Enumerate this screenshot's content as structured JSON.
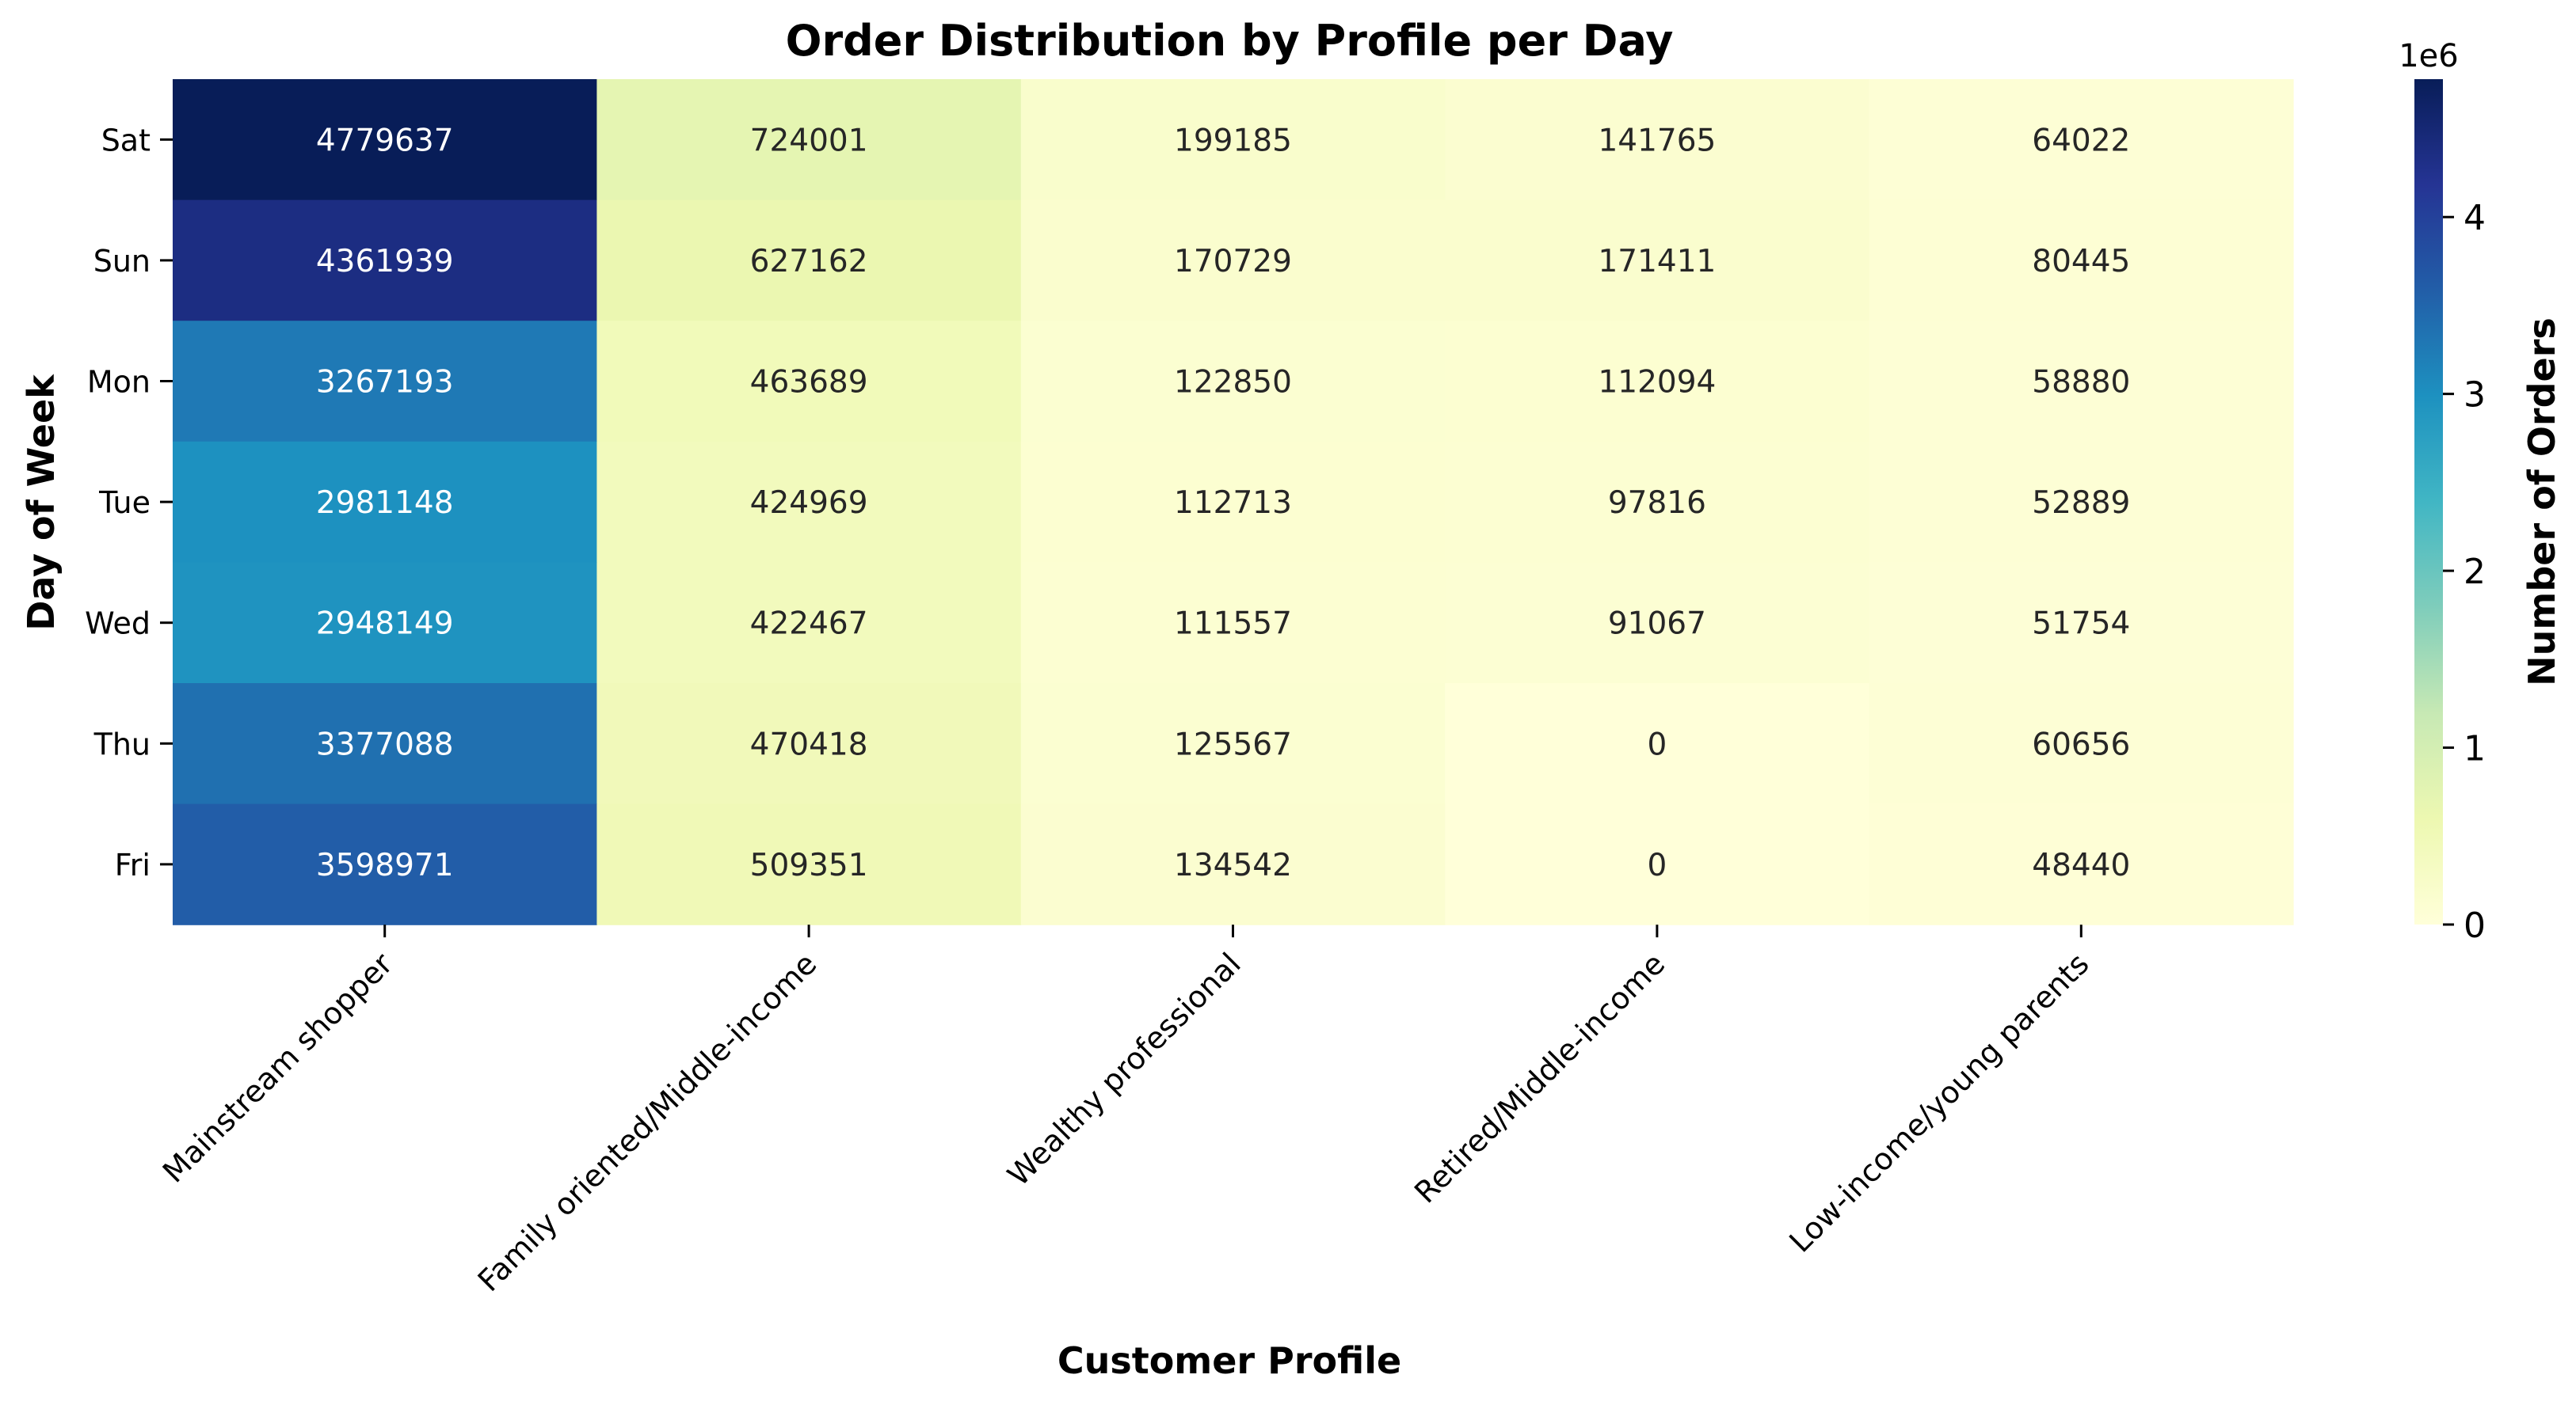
{
  "chart_data": {
    "type": "heatmap",
    "title": "Order Distribution by Profile per Day",
    "xlabel": "Customer Profile",
    "ylabel": "Day of Week",
    "x_categories": [
      "Mainstream shopper",
      "Family oriented/Middle-income",
      "Wealthy professional",
      "Retired/Middle-income",
      "Low-income/young parents"
    ],
    "y_categories": [
      "Sat",
      "Sun",
      "Mon",
      "Tue",
      "Wed",
      "Thu",
      "Fri"
    ],
    "values": [
      [
        4779637,
        724001,
        199185,
        141765,
        64022
      ],
      [
        4361939,
        627162,
        170729,
        171411,
        80445
      ],
      [
        3267193,
        463689,
        122850,
        112094,
        58880
      ],
      [
        2981148,
        424969,
        112713,
        97816,
        52889
      ],
      [
        2948149,
        422467,
        111557,
        91067,
        51754
      ],
      [
        3377088,
        470418,
        125567,
        0,
        60656
      ],
      [
        3598971,
        509351,
        134542,
        0,
        48440
      ]
    ],
    "colormap": "YlGnBu",
    "colorbar": {
      "label": "Number of Orders",
      "range": [
        0,
        4779637
      ],
      "ticks": [
        0,
        1,
        2,
        3,
        4
      ],
      "multiplier_label": "1e6"
    },
    "grid": false,
    "legend": "colorbar-right"
  }
}
